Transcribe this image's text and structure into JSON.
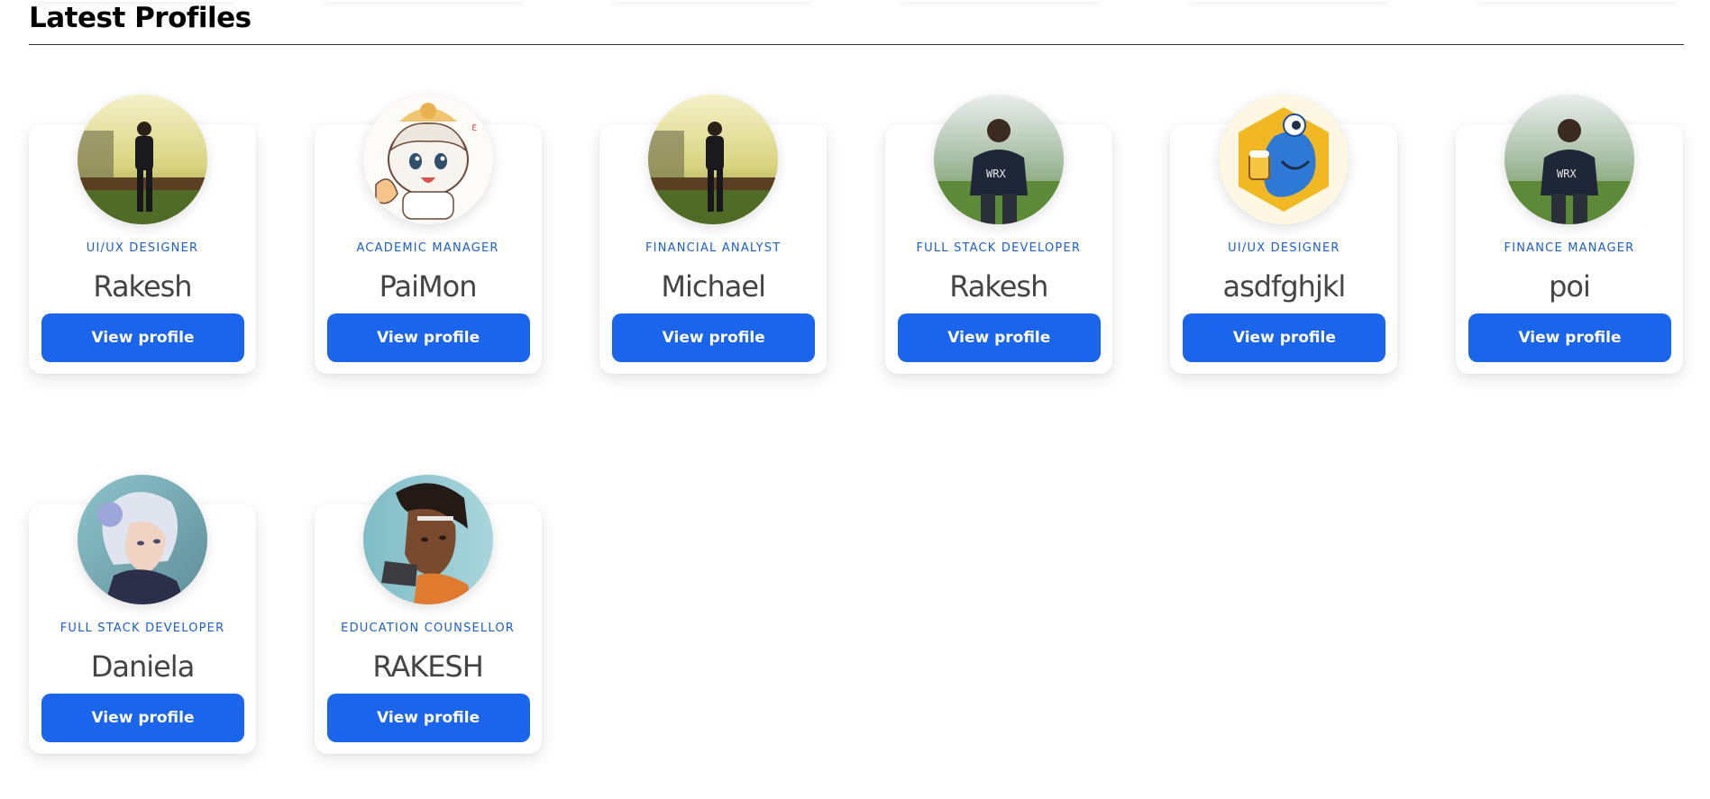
{
  "section": {
    "title": "Latest Profiles"
  },
  "profiles": [
    {
      "role": "UI/UX DESIGNER",
      "name": "Rakesh",
      "button": "View profile",
      "avatar": "man-standing-field-photo"
    },
    {
      "role": "ACADEMIC MANAGER",
      "name": "PaiMon",
      "button": "View profile",
      "avatar": "anime-character-illustration"
    },
    {
      "role": "FINANCIAL ANALYST",
      "name": "Michael",
      "button": "View profile",
      "avatar": "man-standing-field-photo"
    },
    {
      "role": "FULL STACK DEVELOPER",
      "name": "Rakesh",
      "button": "View profile",
      "avatar": "man-tea-garden-photo"
    },
    {
      "role": "UI/UX DESIGNER",
      "name": "asdfghjkl",
      "button": "View profile",
      "avatar": "blue-mascot-hexagon-logo"
    },
    {
      "role": "FINANCE MANAGER",
      "name": "poi",
      "button": "View profile",
      "avatar": "man-tea-garden-photo"
    },
    {
      "role": "FULL STACK DEVELOPER",
      "name": "Daniela",
      "button": "View profile",
      "avatar": "silver-haired-game-character"
    },
    {
      "role": "EDUCATION COUNSELLOR",
      "name": "RAKESH",
      "button": "View profile",
      "avatar": "game-character-portrait"
    }
  ],
  "colors": {
    "accent": "#1a65eb",
    "role_text": "#1d5fc9",
    "name_text": "#444444"
  }
}
